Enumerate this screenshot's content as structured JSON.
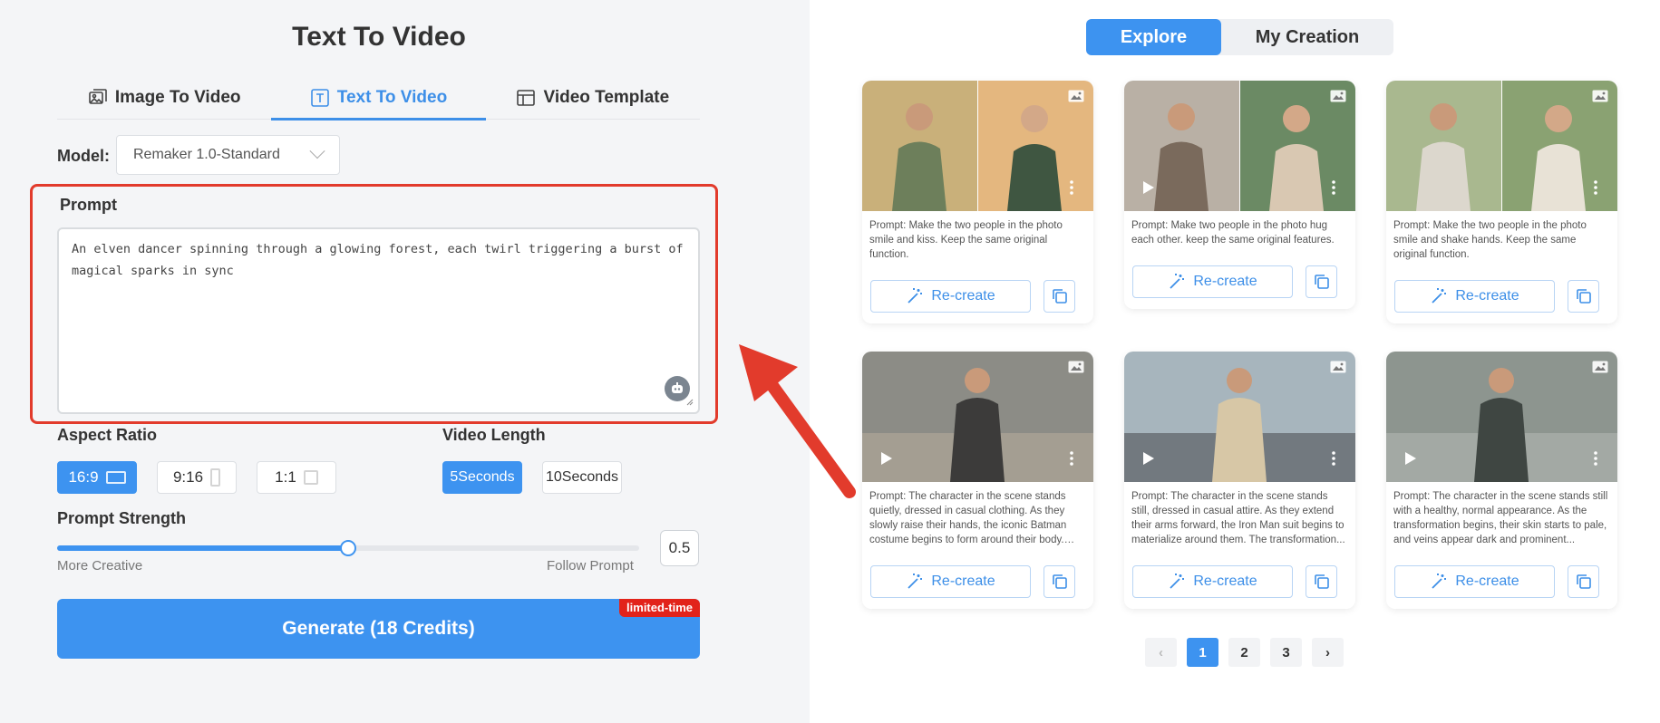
{
  "left": {
    "title": "Text To Video",
    "tabs": [
      {
        "label": "Image To Video",
        "icon": "image-to-video-icon"
      },
      {
        "label": "Text To Video",
        "icon": "text-icon",
        "active": true
      },
      {
        "label": "Video Template",
        "icon": "template-icon"
      }
    ],
    "model_label": "Model:",
    "model_value": "Remaker 1.0-Standard",
    "prompt_label": "Prompt",
    "prompt_value": "An elven dancer spinning through a glowing forest, each twirl triggering a burst of magical sparks in sync",
    "aspect_ratio_label": "Aspect Ratio",
    "aspect_ratios": [
      {
        "label": "16:9",
        "active": true
      },
      {
        "label": "9:16"
      },
      {
        "label": "1:1"
      }
    ],
    "video_length_label": "Video Length",
    "video_lengths": [
      {
        "label": "5Seconds",
        "active": true
      },
      {
        "label": "10Seconds"
      }
    ],
    "prompt_strength_label": "Prompt Strength",
    "strength_value": "0.5",
    "strength_fraction": 0.5,
    "more_creative": "More Creative",
    "follow_prompt": "Follow Prompt",
    "generate_label": "Generate (18 Credits)",
    "limited_badge": "limited-time"
  },
  "right": {
    "tabs": {
      "explore": "Explore",
      "my_creation": "My Creation"
    },
    "recreate_label": "Re-create",
    "cards": [
      {
        "prompt": "Prompt: Make the two people in the photo smile and kiss. Keep the same original function."
      },
      {
        "prompt": "Prompt: Make two people in the photo hug each other. keep the same original features."
      },
      {
        "prompt": "Prompt: Make the two people in the photo smile and shake hands. Keep the same original function."
      },
      {
        "prompt": "Prompt: The character in the scene stands quietly, dressed in casual clothing. As they slowly raise their hands, the iconic Batman costume begins to form around their body. The..."
      },
      {
        "prompt": "Prompt: The character in the scene stands still, dressed in casual attire. As they extend their arms forward, the Iron Man suit begins to materialize around them. The transformation..."
      },
      {
        "prompt": "Prompt: The character in the scene stands still with a healthy, normal appearance. As the transformation begins, their skin starts to pale, and veins appear dark and prominent..."
      }
    ],
    "pagination": {
      "prev": "‹",
      "pages": [
        "1",
        "2",
        "3"
      ],
      "active": "1",
      "next": "›"
    }
  },
  "colors": {
    "accent": "#3d93f0",
    "highlight_border": "#e23b2c",
    "badge": "#e2231a"
  }
}
